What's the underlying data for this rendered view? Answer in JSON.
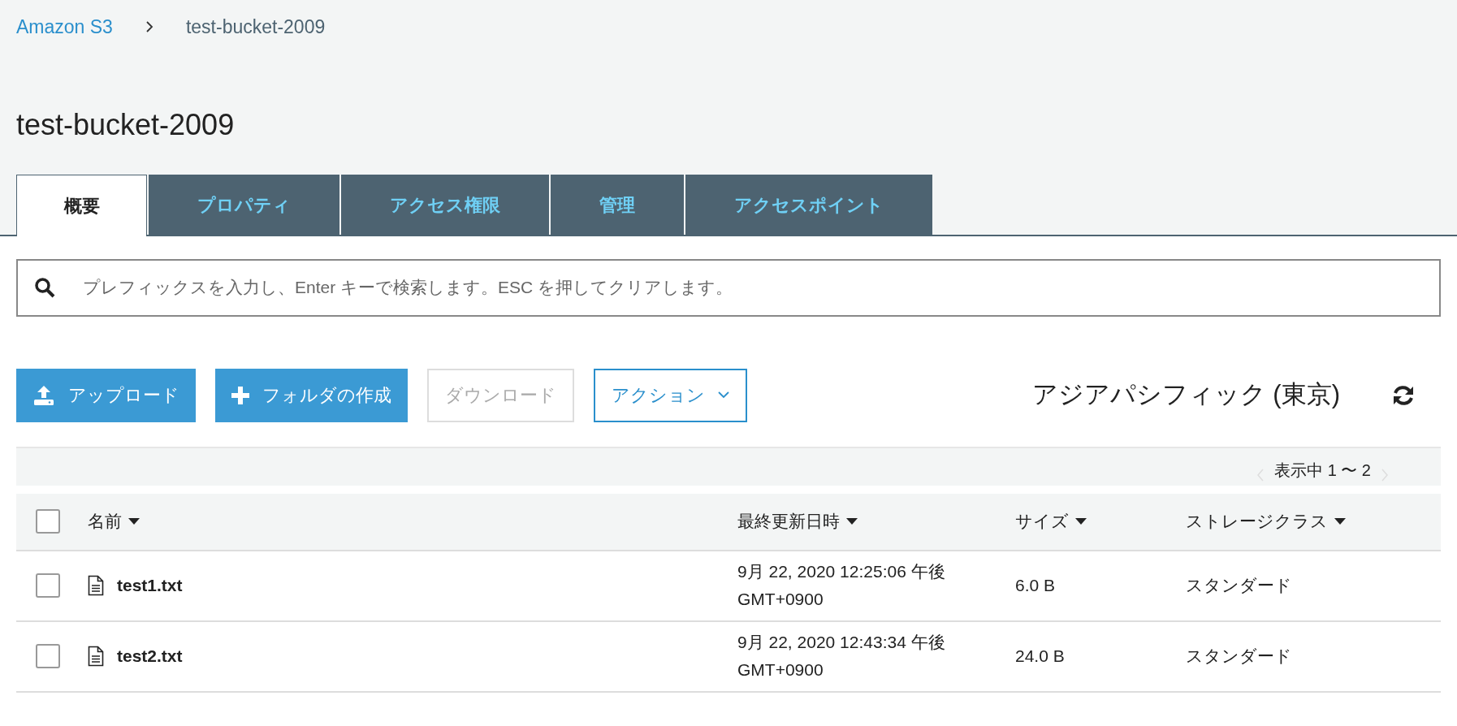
{
  "breadcrumb": [
    {
      "label": "Amazon S3",
      "link": true
    },
    {
      "label": "test-bucket-2009",
      "link": false
    }
  ],
  "title": "test-bucket-2009",
  "tabs": [
    {
      "label": "概要",
      "selected": true
    },
    {
      "label": "プロパティ",
      "selected": false
    },
    {
      "label": "アクセス権限",
      "selected": false
    },
    {
      "label": "管理",
      "selected": false
    },
    {
      "label": "アクセスポイント",
      "selected": false
    }
  ],
  "search": {
    "placeholder": "プレフィックスを入力し、Enter キーで検索します。ESC を押してクリアします。"
  },
  "buttons": [
    {
      "kind": "upload",
      "label": "アップロード",
      "disabled": false
    },
    {
      "kind": "create",
      "label": "フォルダの作成",
      "disabled": false
    },
    {
      "kind": "plain",
      "label": "ダウンロード",
      "disabled": true
    },
    {
      "kind": "dropdown",
      "label": "アクション",
      "disabled": false
    }
  ],
  "region": "アジアパシフィック (東京)",
  "pagination": {
    "label": "表示中 1 〜 2",
    "prev_disabled": true,
    "next_disabled": true
  },
  "table": {
    "select_all_checked": false,
    "columns": [
      "名前",
      "最終更新日時",
      "サイズ",
      "ストレージクラス"
    ],
    "rows": [
      {
        "checked": false,
        "name": "test1.txt",
        "modified": "9月 22, 2020 12:25:06 午後",
        "timezone": "GMT+0900",
        "size": "6.0 B",
        "storage_class": "スタンダード"
      },
      {
        "checked": false,
        "name": "test2.txt",
        "modified": "9月 22, 2020 12:43:34 午後",
        "timezone": "GMT+0900",
        "size": "24.0 B",
        "storage_class": "スタンダード"
      }
    ]
  }
}
